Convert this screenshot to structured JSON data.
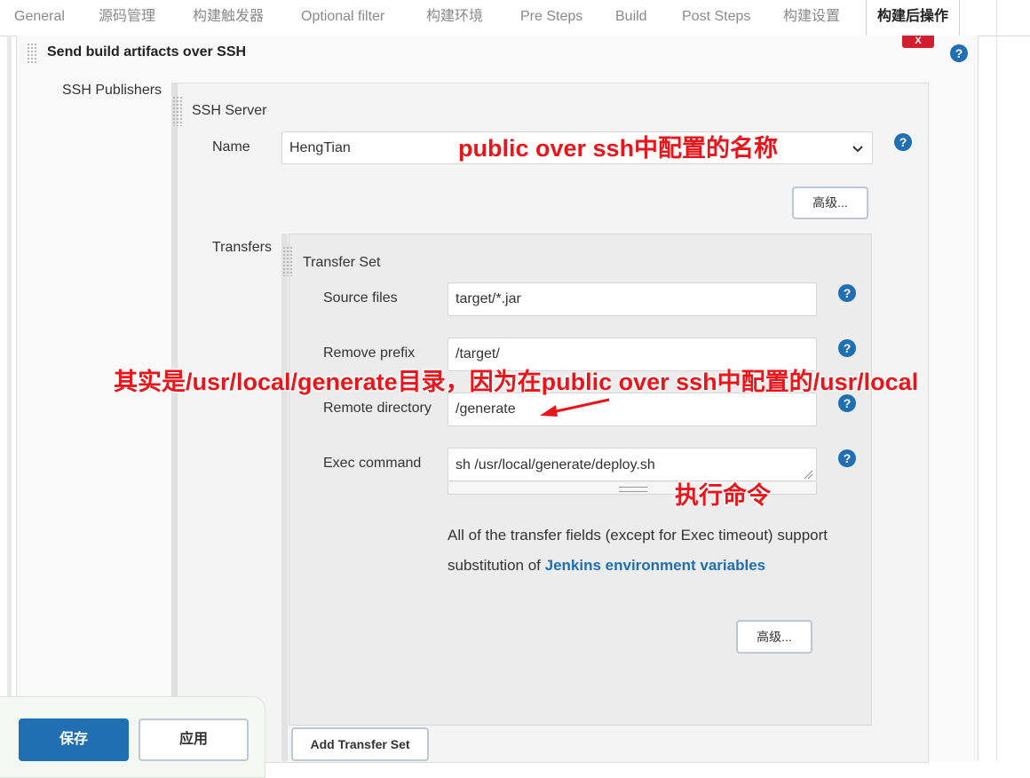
{
  "tabs": [
    {
      "label": "General"
    },
    {
      "label": "源码管理"
    },
    {
      "label": "构建触发器"
    },
    {
      "label": "Optional filter"
    },
    {
      "label": "构建环境"
    },
    {
      "label": "Pre Steps"
    },
    {
      "label": "Build"
    },
    {
      "label": "Post Steps"
    },
    {
      "label": "构建设置"
    },
    {
      "label": "构建后操作"
    }
  ],
  "section": {
    "title": "Send build artifacts over SSH",
    "delete_label": "X",
    "ssh_publishers_label": "SSH Publishers",
    "ssh_server_label": "SSH Server",
    "name_label": "Name",
    "name_value": "HengTian",
    "advanced_label": "高级...",
    "transfers_label": "Transfers"
  },
  "transfer_set": {
    "title": "Transfer Set",
    "source_files_label": "Source files",
    "source_files_value": "target/*.jar",
    "remove_prefix_label": "Remove prefix",
    "remove_prefix_value": "/target/",
    "remote_directory_label": "Remote directory",
    "remote_directory_value": "/generate",
    "exec_command_label": "Exec command",
    "exec_command_value": "sh /usr/local/generate/deploy.sh",
    "info_text": "All of the transfer fields (except for Exec timeout) support substitution of ",
    "info_link": "Jenkins environment variables",
    "advanced_label": "高级...",
    "add_transfer_set_label": "Add Transfer Set"
  },
  "help_label": "?",
  "footer": {
    "save_label": "保存",
    "apply_label": "应用"
  },
  "annotations": {
    "name_note": "public over ssh中配置的名称",
    "dir_note": "其实是/usr/local/generate目录，因为在public over ssh中配置的/usr/local",
    "exec_note": "执行命令"
  },
  "colors": {
    "accent": "#1f6fb2",
    "annotation": "#e8161b",
    "delete": "#d01f2f"
  }
}
